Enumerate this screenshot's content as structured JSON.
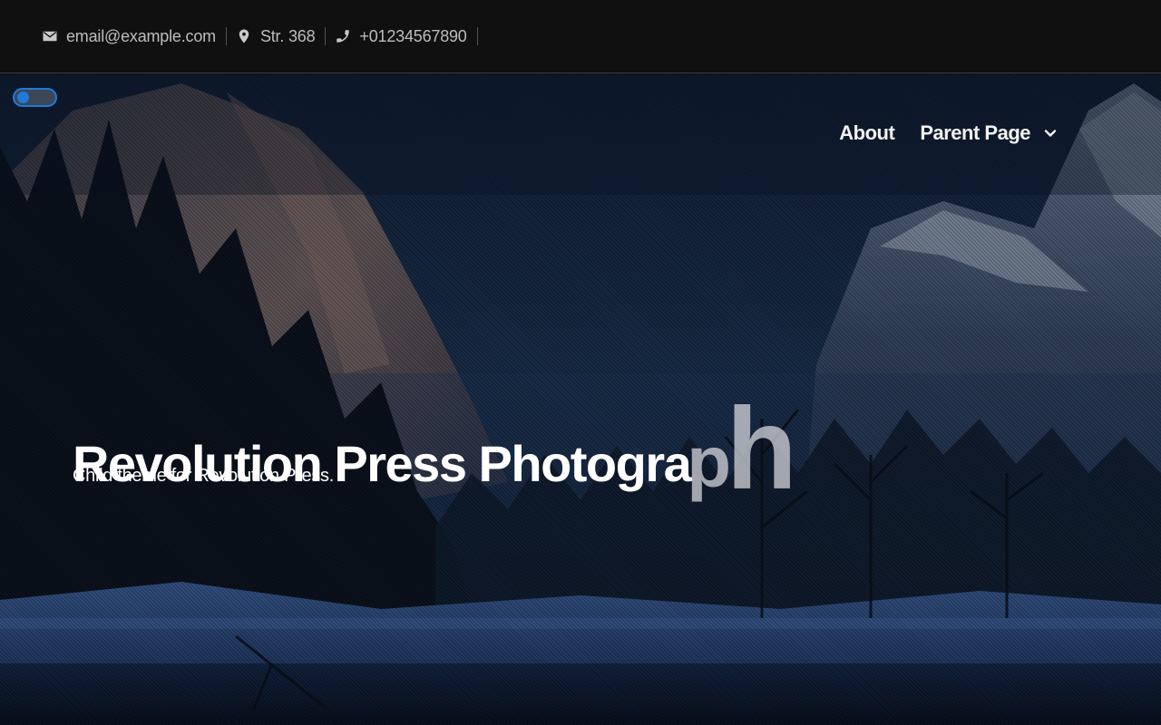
{
  "topbar": {
    "email": {
      "icon": "envelope-icon",
      "text": "email@example.com"
    },
    "address": {
      "icon": "map-pin-icon",
      "text": "Str. 368"
    },
    "phone": {
      "icon": "phone-icon",
      "text": "+01234567890"
    }
  },
  "header": {
    "dark_mode_toggle": {
      "state": "on",
      "accent": "#1e7bd8"
    },
    "nav": {
      "items": [
        {
          "label": "About"
        },
        {
          "label": "Parent Page",
          "icon": "chevron-down-icon"
        }
      ]
    }
  },
  "hero": {
    "title_main": "Revolution Press Photogra",
    "title_anim_p": "p",
    "title_anim_h": "h",
    "subtitle": "Child theme for Revolution Press.",
    "background": "night mountain valley with snowy riverbank"
  },
  "colors": {
    "topbar_bg": "#101010",
    "accent": "#1e7bd8",
    "text": "#ffffff"
  }
}
